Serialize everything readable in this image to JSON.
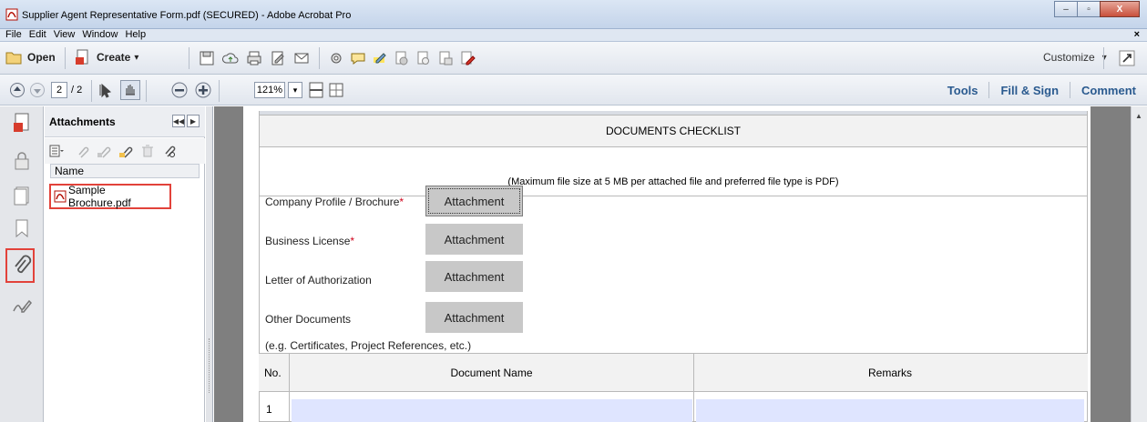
{
  "window": {
    "title": "Supplier Agent Representative Form.pdf (SECURED) - Adobe Acrobat Pro",
    "minimize": "–",
    "maximize": "▫",
    "close": "X"
  },
  "menubar": {
    "items": [
      "File",
      "Edit",
      "View",
      "Window",
      "Help"
    ],
    "close_glyph": "×"
  },
  "toolbar": {
    "open_label": "Open",
    "create_label": "Create",
    "create_caret": "▾",
    "customize_label": "Customize",
    "customize_caret": "▾"
  },
  "navbar": {
    "current_page": "2",
    "total_pages": "/ 2",
    "zoom": "121%",
    "zoom_caret": "▾",
    "tools_label": "Tools",
    "fill_sign_label": "Fill & Sign",
    "comment_label": "Comment"
  },
  "attachments_panel": {
    "title": "Attachments",
    "column_header": "Name",
    "items": [
      {
        "name": "Sample Brochure.pdf"
      }
    ]
  },
  "form": {
    "section_title": "DOCUMENTS CHECKLIST",
    "subtitle": "(Maximum file size at 5 MB per attached file and preferred file type is PDF)",
    "rows": [
      {
        "label": "Company Profile / Brochure",
        "required": "*",
        "button": "Attachment"
      },
      {
        "label": "Business License",
        "required": "*",
        "button": "Attachment"
      },
      {
        "label": "Letter of Authorization",
        "required": "",
        "button": "Attachment"
      },
      {
        "label": "Other Documents",
        "required": "",
        "button": "Attachment"
      }
    ],
    "hint": "(e.g. Certificates, Project References, etc.)",
    "table": {
      "headers": [
        "No.",
        "Document Name",
        "Remarks"
      ],
      "rows": [
        {
          "no": "1",
          "document_name": "",
          "remarks": ""
        }
      ]
    }
  },
  "colors": {
    "highlight_red": "#e2423a",
    "field_fill": "#dfe5ff",
    "link_blue": "#2a5a8f",
    "required_red": "#d0021b",
    "button_gray": "#c8c8c8"
  }
}
